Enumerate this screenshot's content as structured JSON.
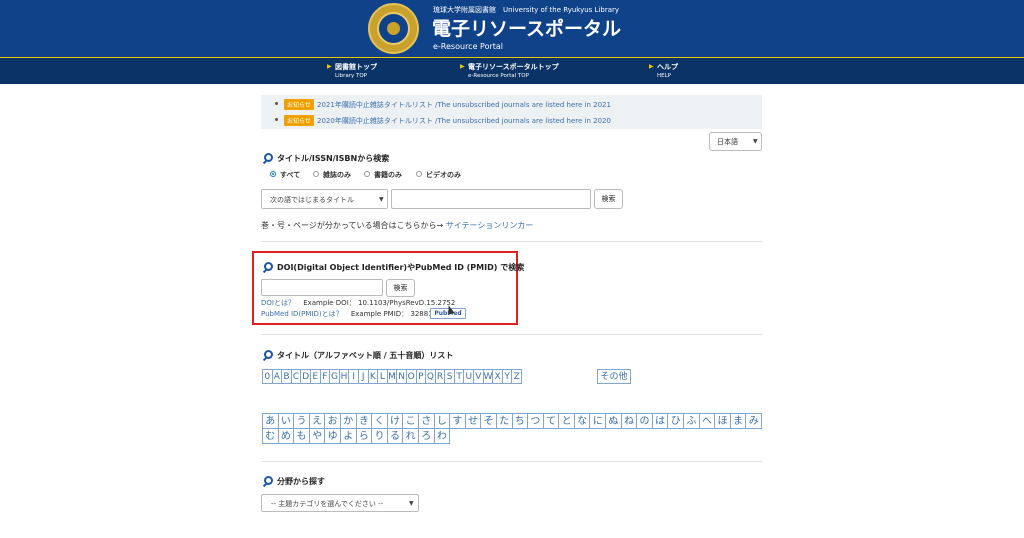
{
  "header": {
    "library_name": "琉球大学附属図書館　University of the Ryukyus Library",
    "portal_title": "電子リソースポータル",
    "portal_subtitle": "e-Resource Portal",
    "bg_color": "#10428a"
  },
  "nav": [
    {
      "label": "図書館トップ",
      "sub": "Library TOP"
    },
    {
      "label": "電子リソースポータルトップ",
      "sub": "e-Resource Portal TOP"
    },
    {
      "label": "ヘルプ",
      "sub": "HELP"
    }
  ],
  "notices": [
    {
      "badge": "お知らせ",
      "text": "2021年購読中止雑誌タイトルリスト /The unsubscribed journals are listed here in 2021"
    },
    {
      "badge": "お知らせ",
      "text": "2020年購読中止雑誌タイトルリスト /The unsubscribed journals are listed here in 2020"
    }
  ],
  "language_select": {
    "value": "日本語"
  },
  "title_search": {
    "heading": "タイトル/ISSN/ISBNから検索",
    "radios": [
      {
        "label": "すべて",
        "checked": true
      },
      {
        "label": "雑誌のみ",
        "checked": false
      },
      {
        "label": "書籍のみ",
        "checked": false
      },
      {
        "label": "ビデオのみ",
        "checked": false
      }
    ],
    "mode_select": "次の語ではじまるタイトル",
    "query": "",
    "button": "検索",
    "citation_text": "巻・号・ページが分かっている場合はこちらから→",
    "citation_link": "サイテーションリンカー"
  },
  "doi_search": {
    "heading": "DOI(Digital Object Identifier)やPubMed ID (PMID) で検索",
    "query": "",
    "button": "検索",
    "doi_link": "DOIとは？",
    "doi_example": "Example DOI： 10.1103/PhysRevD.15.2752",
    "pmid_link": "PubMed ID(PMID)とは？",
    "pmid_example": "Example PMID： 32881",
    "pubmed_logo": "PubMed",
    "highlight_color": "#e02020"
  },
  "title_list": {
    "heading": "タイトル（アルファベット順 / 五十音順）リスト",
    "alphabet": [
      "0",
      "A",
      "B",
      "C",
      "D",
      "E",
      "F",
      "G",
      "H",
      "I",
      "J",
      "K",
      "L",
      "M",
      "N",
      "O",
      "P",
      "Q",
      "R",
      "S",
      "T",
      "U",
      "V",
      "W",
      "X",
      "Y",
      "Z"
    ],
    "other": "その他",
    "kana": [
      "あ",
      "い",
      "う",
      "え",
      "お",
      "か",
      "き",
      "く",
      "け",
      "こ",
      "さ",
      "し",
      "す",
      "せ",
      "そ",
      "た",
      "ち",
      "つ",
      "て",
      "と",
      "な",
      "に",
      "ぬ",
      "ね",
      "の",
      "は",
      "ひ",
      "ふ",
      "へ",
      "ほ",
      "ま",
      "み",
      "む",
      "め",
      "も",
      "や",
      "ゆ",
      "よ",
      "ら",
      "り",
      "る",
      "れ",
      "ろ",
      "わ"
    ]
  },
  "subject_search": {
    "heading": "分野から探す",
    "select": "-- 主題カテゴリを選んでください --"
  }
}
